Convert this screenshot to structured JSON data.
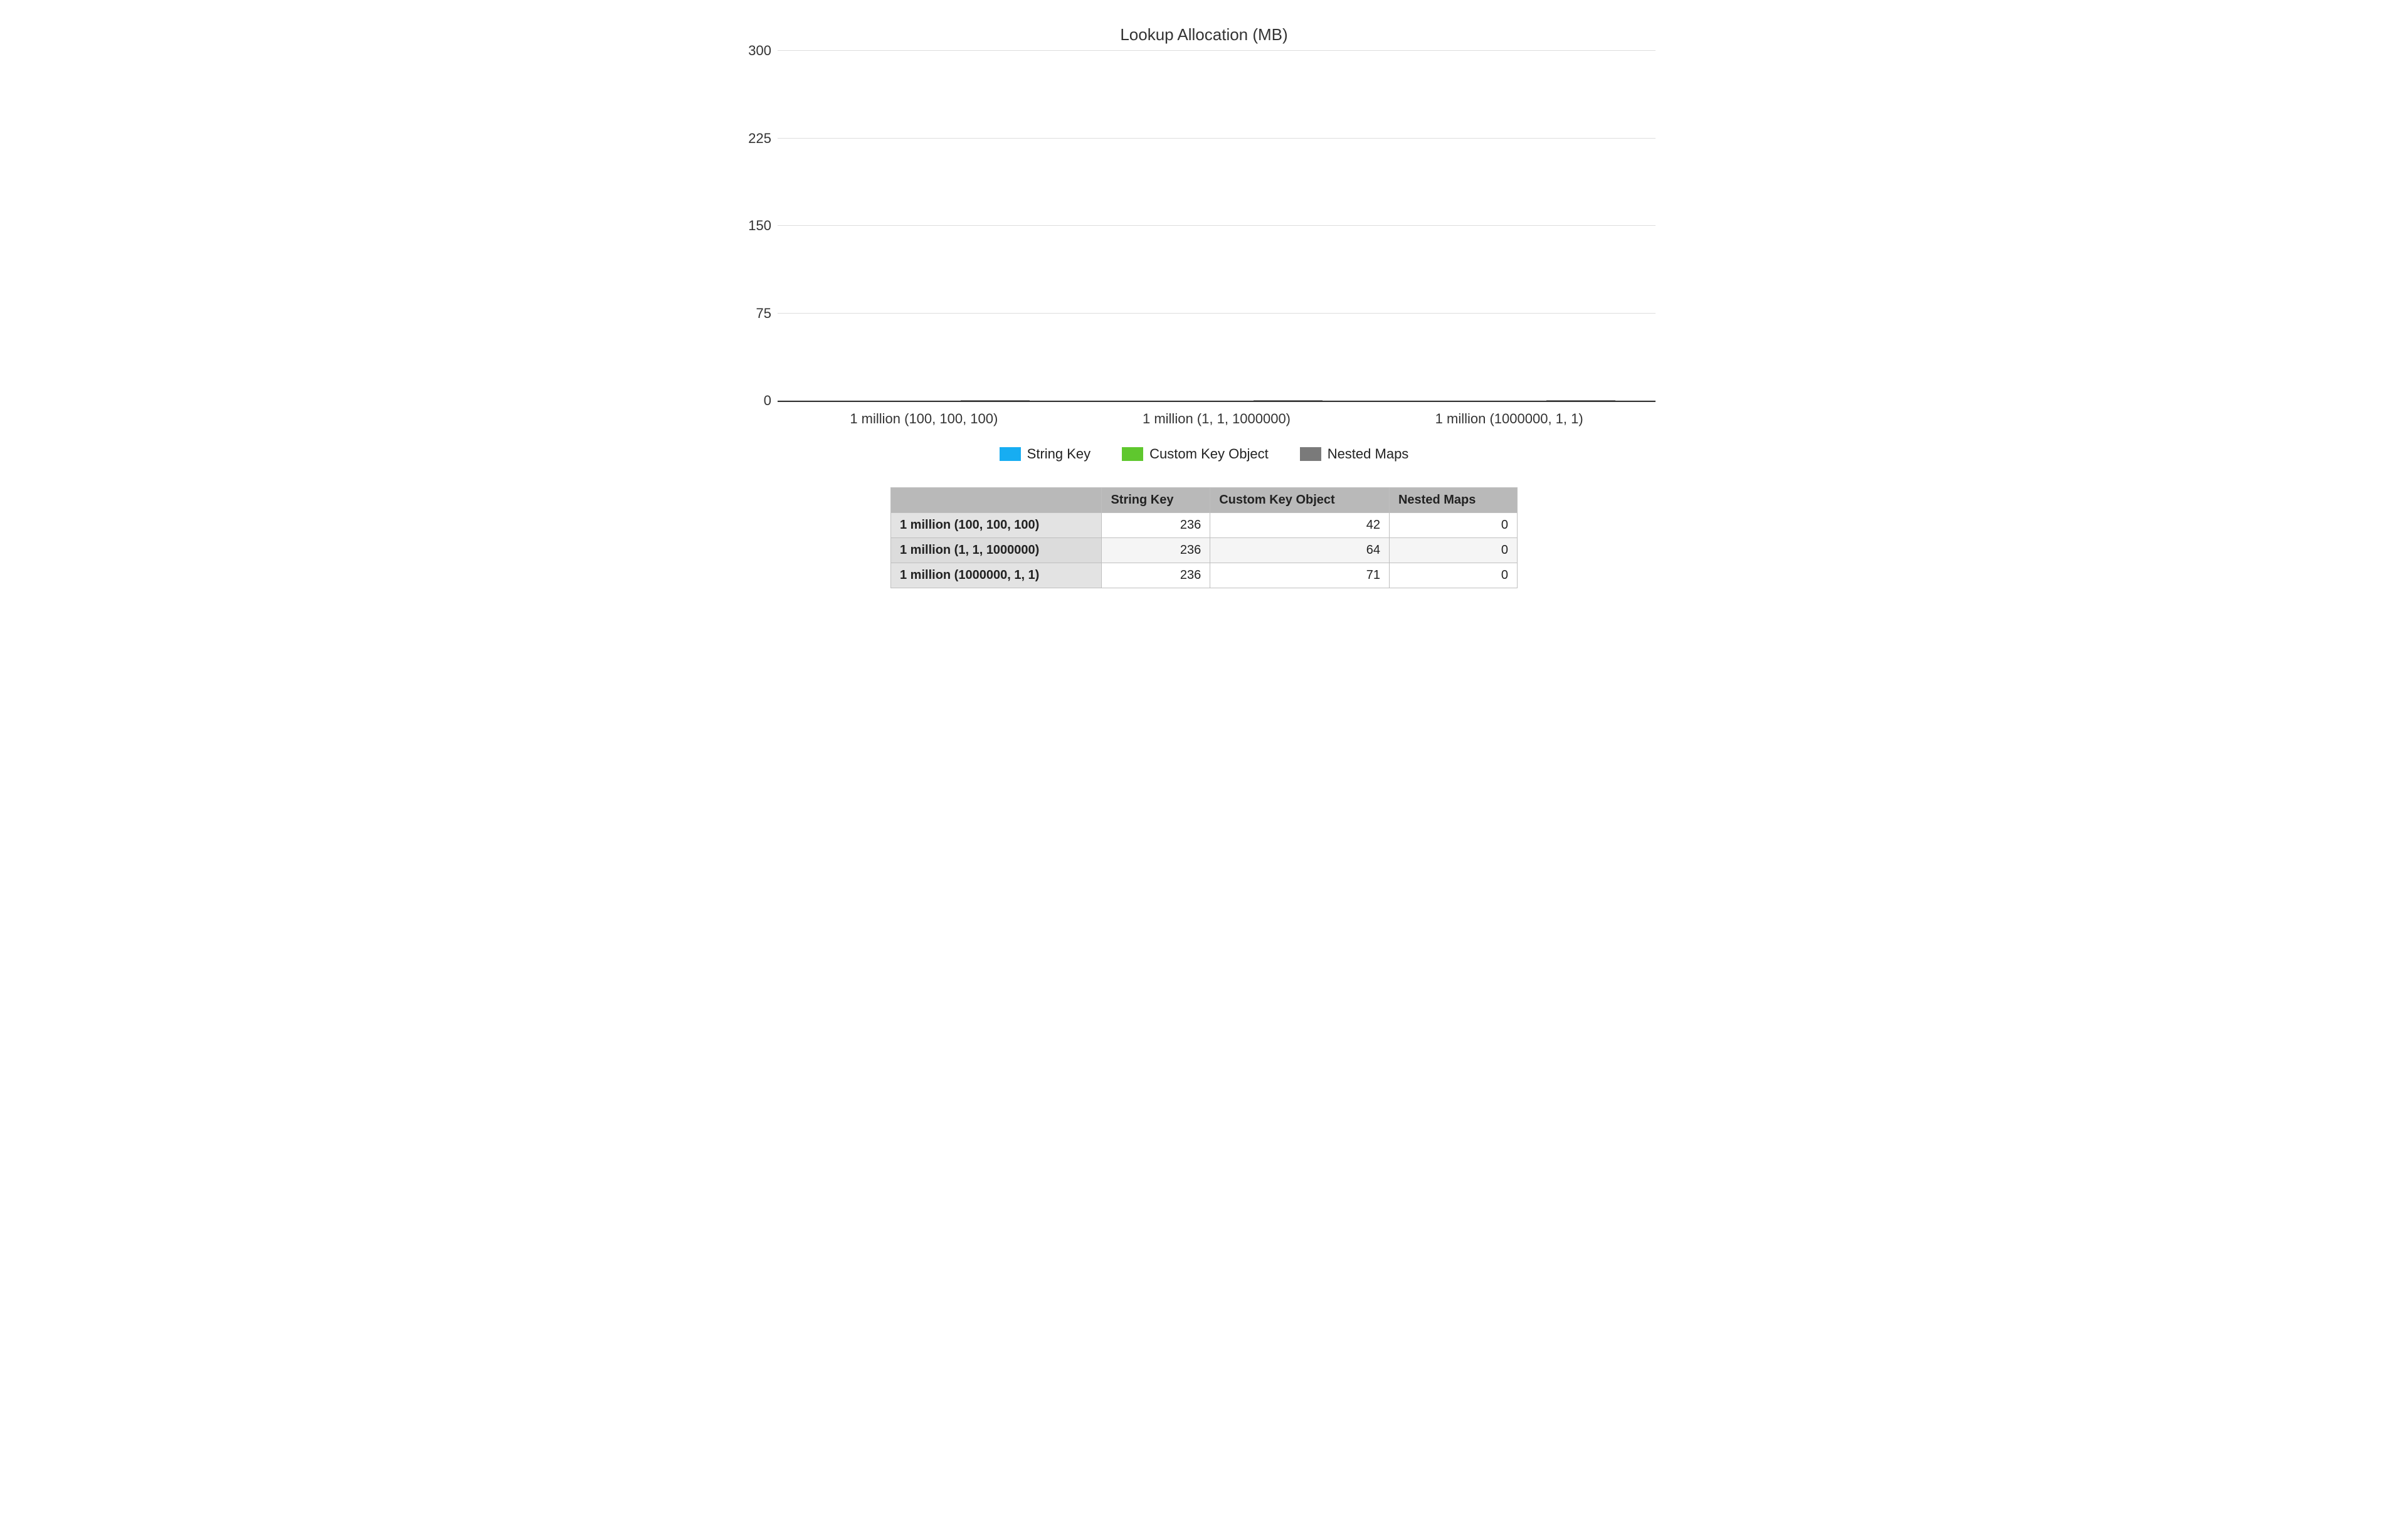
{
  "chart_data": {
    "type": "bar",
    "title": "Lookup Allocation (MB)",
    "xlabel": "",
    "ylabel": "",
    "ylim": [
      0,
      300
    ],
    "yticks": [
      0,
      75,
      150,
      225,
      300
    ],
    "categories": [
      "1 million (100, 100, 100)",
      "1 million (1, 1, 1000000)",
      "1 million (1000000, 1, 1)"
    ],
    "series": [
      {
        "name": "String Key",
        "color": "#17ADF2",
        "values": [
          236,
          236,
          236
        ]
      },
      {
        "name": "Custom Key Object",
        "color": "#5FC72E",
        "values": [
          42,
          64,
          71
        ]
      },
      {
        "name": "Nested Maps",
        "color": "#7a7a7a",
        "values": [
          0,
          0,
          0
        ]
      }
    ]
  },
  "table": {
    "corner": "",
    "headers": [
      "String Key",
      "Custom Key Object",
      "Nested Maps"
    ],
    "rows": [
      {
        "label": "1 million (100, 100, 100)",
        "cells": [
          "236",
          "42",
          "0"
        ]
      },
      {
        "label": "1 million (1, 1, 1000000)",
        "cells": [
          "236",
          "64",
          "0"
        ]
      },
      {
        "label": "1 million (1000000, 1, 1)",
        "cells": [
          "236",
          "71",
          "0"
        ]
      }
    ]
  }
}
